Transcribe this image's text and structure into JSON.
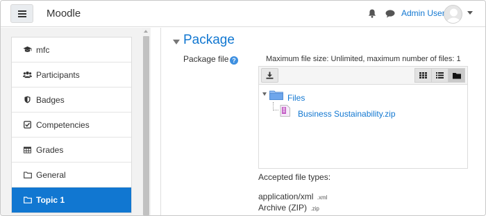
{
  "navbar": {
    "brand": "Moodle",
    "user_name": "Admin User"
  },
  "sidebar": {
    "items": [
      {
        "label": "mfc",
        "icon": "graduation-cap-icon"
      },
      {
        "label": "Participants",
        "icon": "users-icon"
      },
      {
        "label": "Badges",
        "icon": "shield-icon"
      },
      {
        "label": "Competencies",
        "icon": "check-square-icon"
      },
      {
        "label": "Grades",
        "icon": "table-icon"
      },
      {
        "label": "General",
        "icon": "folder-icon"
      },
      {
        "label": "Topic 1",
        "icon": "folder-icon",
        "active": true
      }
    ]
  },
  "section": {
    "title": "Package",
    "field_label": "Package file",
    "max_size_text": "Maximum file size: Unlimited, maximum number of files: 1"
  },
  "filepicker": {
    "folder_label": "Files",
    "file_name": "Business Sustainability.zip",
    "active_view": "tree"
  },
  "accepted": {
    "heading": "Accepted file types:",
    "types": [
      {
        "name": "application/xml",
        "ext": ".xml"
      },
      {
        "name": "Archive (ZIP)",
        "ext": ".zip"
      }
    ]
  },
  "colors": {
    "accent": "#1177d1",
    "active_bg": "#1177d1",
    "drawer_bg": "#f2f2f2"
  }
}
